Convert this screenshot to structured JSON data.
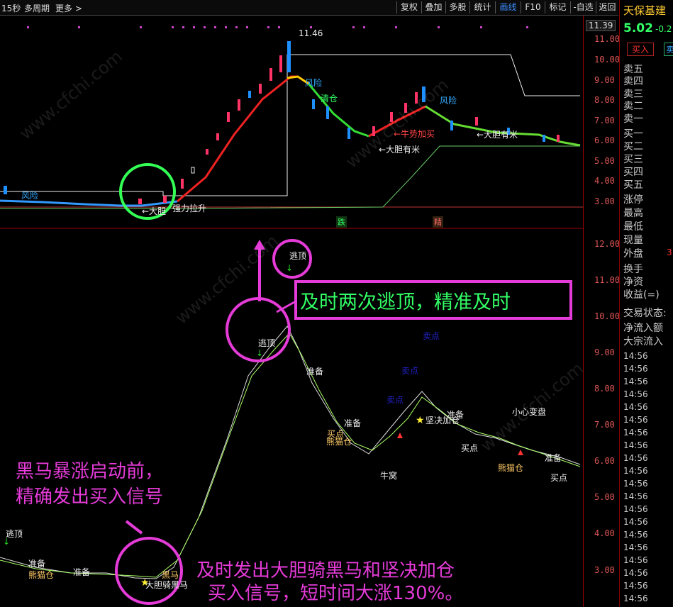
{
  "toolbar": {
    "period": "15秒",
    "multi_period": "多周期",
    "more": "更多 >",
    "buttons": [
      "复权",
      "叠加",
      "多股",
      "统计",
      "画线",
      "F10",
      "标记",
      "-自选",
      "返回"
    ],
    "active_button": "画线"
  },
  "stock": {
    "name": "天保基建",
    "price": "5.02",
    "change": "-0.2",
    "buy_button": "买入",
    "sell_button": "卖",
    "top_axis_tag": "11.39"
  },
  "order_book": [
    "卖五",
    "卖四",
    "卖三",
    "卖二",
    "卖一",
    "买一",
    "买二",
    "买三",
    "买四",
    "买五"
  ],
  "stats": [
    "涨停",
    "最高",
    "最低",
    "现量",
    "外盘"
  ],
  "stats_extra": "3",
  "info": [
    "换手",
    "净资",
    "收益(=)"
  ],
  "trade": [
    "交易状态:",
    "净流入额",
    "大宗流入"
  ],
  "times": [
    "14:56",
    "14:56",
    "14:56",
    "14:56",
    "14:56",
    "14:56",
    "14:56",
    "14:56",
    "14:56",
    "14:56",
    "14:56",
    "14:56",
    "14:56",
    "14:56",
    "14:56",
    "14:56",
    "14:56",
    "14:56",
    "14:56",
    "14:56",
    "14:56"
  ],
  "upper_axis": [
    "11.00",
    "10.00",
    "9.00",
    "8.00",
    "7.00",
    "6.00",
    "5.00",
    "4.00",
    "3.00"
  ],
  "lower_axis": [
    "12.00",
    "11.00",
    "10.00",
    "9.00",
    "8.00",
    "7.00",
    "6.00",
    "5.00",
    "4.00",
    "3.00"
  ],
  "upper_labels": {
    "high": "11.46",
    "risk1": "风险",
    "risk2": "风险",
    "risk3": "风险",
    "qingcang": "清仓",
    "niushi": "←牛势加买",
    "dadan1": "←大胆有米",
    "dadan2": "←大胆有米",
    "dadan3": "←大胆",
    "lasheng": "强力拉升",
    "die": "跌",
    "jing": "精"
  },
  "lower_labels": {
    "taoding1": "逃顶",
    "taoding2": "逃顶",
    "taoding3": "逃顶",
    "zhunbei": "准备",
    "maidian": "卖点",
    "jianjue": "坚决加仓",
    "xiaoxin": "小心变盘",
    "maidian_buy": "买点",
    "xiongmao": "熊猫仓",
    "niuhu": "牛窝",
    "heima": "黑马",
    "dadanqi": "大胆骑黑马"
  },
  "annotations": {
    "box_text": "及时两次逃顶，精准及时",
    "left_text_1": "黑马暴涨启动前，",
    "left_text_2": "精确发出买入信号",
    "bottom_text_1": "及时发出大胆骑黑马和坚决加仓",
    "bottom_text_2": "买入信号，短时间大涨130%。"
  },
  "watermark": "www.cfchi.com",
  "colors": {
    "magenta": "#e53bd8",
    "rise": "#ff3366",
    "fall": "#1e90ff",
    "green_circle": "#33ff55"
  }
}
